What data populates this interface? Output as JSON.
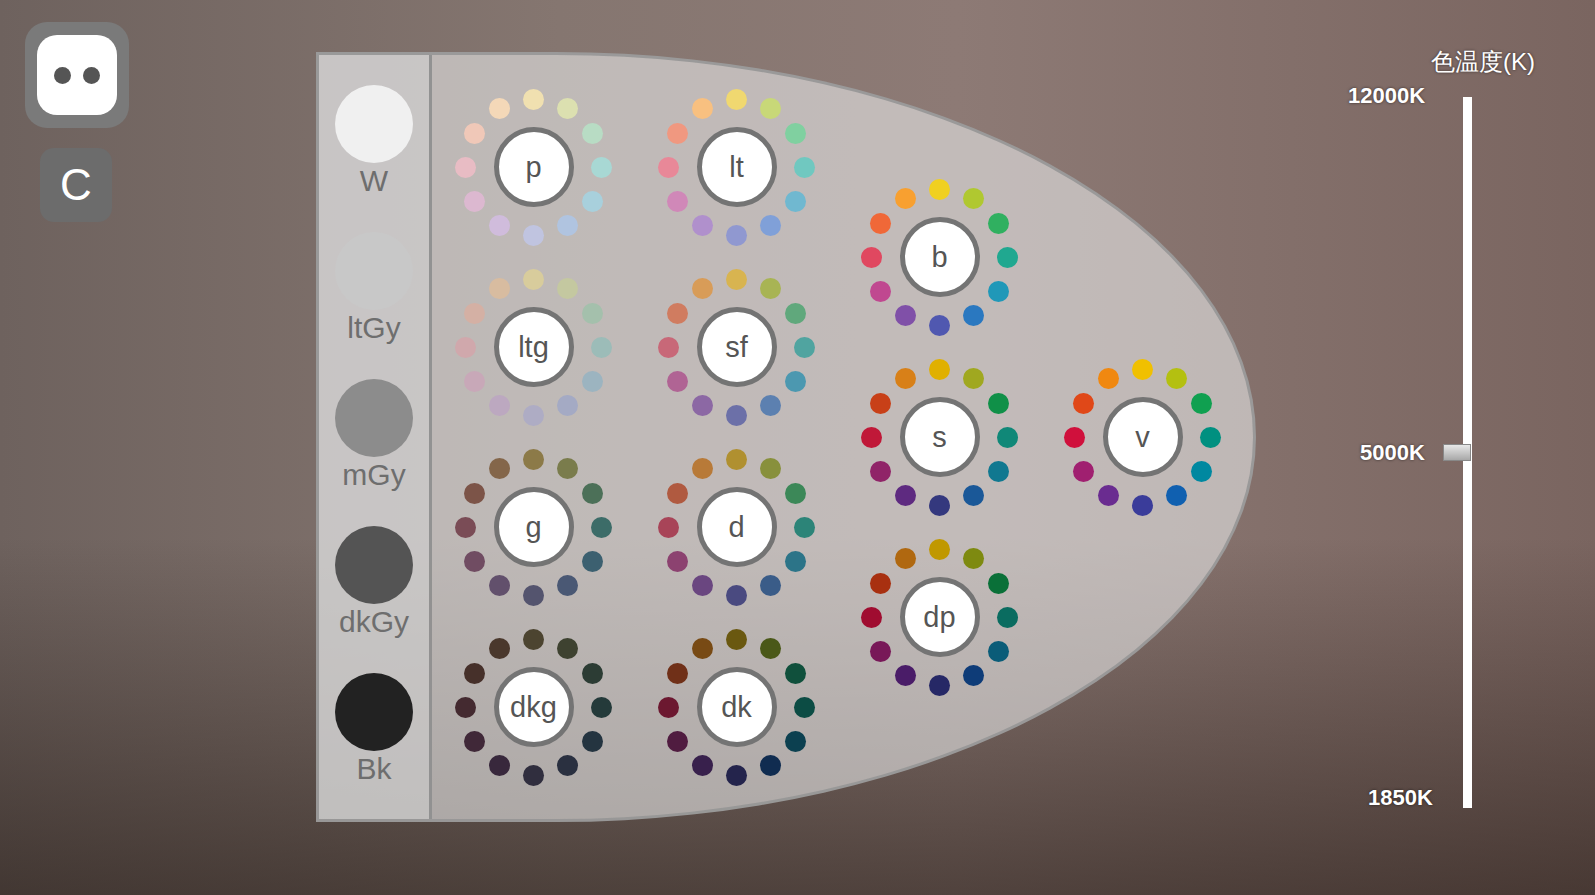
{
  "reset_button": {
    "label": "C"
  },
  "grays": [
    {
      "label": "W",
      "color": "#f0f0f0"
    },
    {
      "label": "ltGy",
      "color": "#c8c8c8"
    },
    {
      "label": "mGy",
      "color": "#8c8c8c"
    },
    {
      "label": "dkGy",
      "color": "#545454"
    },
    {
      "label": "Bk",
      "color": "#222222"
    }
  ],
  "tones": [
    {
      "label": "p",
      "colors": [
        "#f0e0b0",
        "#dce0b0",
        "#b8dcc4",
        "#a8d8d4",
        "#a8d0dc",
        "#b0c4e0",
        "#c0c4e0",
        "#d0bcdc",
        "#dcb8d0",
        "#e8bcc4",
        "#f0c8b8",
        "#f4d8b8"
      ]
    },
    {
      "label": "lt",
      "colors": [
        "#f0d870",
        "#c8d878",
        "#80d0a0",
        "#70c8c0",
        "#70b8d0",
        "#80a0d8",
        "#9098d0",
        "#b090cc",
        "#d088b8",
        "#e88898",
        "#f09880",
        "#f8c080"
      ]
    },
    {
      "label": "b",
      "colors": [
        "#f0d020",
        "#b0c830",
        "#30b060",
        "#20a890",
        "#2098b8",
        "#2a78c0",
        "#5058b0",
        "#8050a8",
        "#c04890",
        "#e04860",
        "#f06838",
        "#f8a030"
      ]
    },
    {
      "label": "ltg",
      "colors": [
        "#d8cc9c",
        "#c4c8a0",
        "#a4c0ac",
        "#9cbcb8",
        "#9cb4c0",
        "#a4aac4",
        "#aeacc4",
        "#bca8c0",
        "#c8a8b8",
        "#d0a8ac",
        "#d4b0a4",
        "#d8bca0"
      ]
    },
    {
      "label": "sf",
      "colors": [
        "#d8b450",
        "#a8b454",
        "#60a87c",
        "#50a4a0",
        "#4c98b0",
        "#5c80b0",
        "#6c70a8",
        "#8c68a4",
        "#b06494",
        "#c86878",
        "#d07c60",
        "#d89c58"
      ]
    },
    {
      "label": "s",
      "colors": [
        "#e0b000",
        "#a0a820",
        "#109048",
        "#108878",
        "#107890",
        "#1a5898",
        "#34387e",
        "#5e2a80",
        "#902468",
        "#c01838",
        "#c84018",
        "#d88018"
      ]
    },
    {
      "label": "v",
      "colors": [
        "#f0c000",
        "#b4c010",
        "#10a050",
        "#009080",
        "#0088a0",
        "#1060b0",
        "#3a3c9a",
        "#6a2c90",
        "#a02070",
        "#d0103c",
        "#e04818",
        "#f08810"
      ]
    },
    {
      "label": "g",
      "colors": [
        "#8c7a48",
        "#7a7c4c",
        "#4c7058",
        "#3c6c68",
        "#3c6070",
        "#4a5874",
        "#54546e",
        "#62506c",
        "#704c62",
        "#7a4c56",
        "#7c5448",
        "#84664a"
      ]
    },
    {
      "label": "d",
      "colors": [
        "#b09030",
        "#88903c",
        "#3c8858",
        "#2c8478",
        "#2c7488",
        "#3a5c88",
        "#4a4a80",
        "#6a4680",
        "#8c4270",
        "#a84458",
        "#b05a40",
        "#b87a38"
      ]
    },
    {
      "label": "dp",
      "colors": [
        "#c09800",
        "#7e8a10",
        "#0a7038",
        "#0a6c60",
        "#0a5c78",
        "#0e3c78",
        "#262866",
        "#4a1c68",
        "#781858",
        "#a00c30",
        "#a83010",
        "#b06810"
      ]
    },
    {
      "label": "dkg",
      "colors": [
        "#4c4430",
        "#3e4230",
        "#2c3c34",
        "#243a3a",
        "#243440",
        "#2a3040",
        "#302e3e",
        "#38283c",
        "#402838",
        "#442a30",
        "#46302a",
        "#4a382c"
      ]
    },
    {
      "label": "dk",
      "colors": [
        "#6a5810",
        "#4a5818",
        "#10503c",
        "#0c4c44",
        "#0c4050",
        "#102c50",
        "#24244c",
        "#38204c",
        "#501c40",
        "#6c1830",
        "#703018",
        "#784a14"
      ]
    }
  ],
  "color_temperature": {
    "title": "色温度(K)",
    "max": "12000K",
    "value": "5000K",
    "min": "1850K",
    "level": 0.5
  }
}
